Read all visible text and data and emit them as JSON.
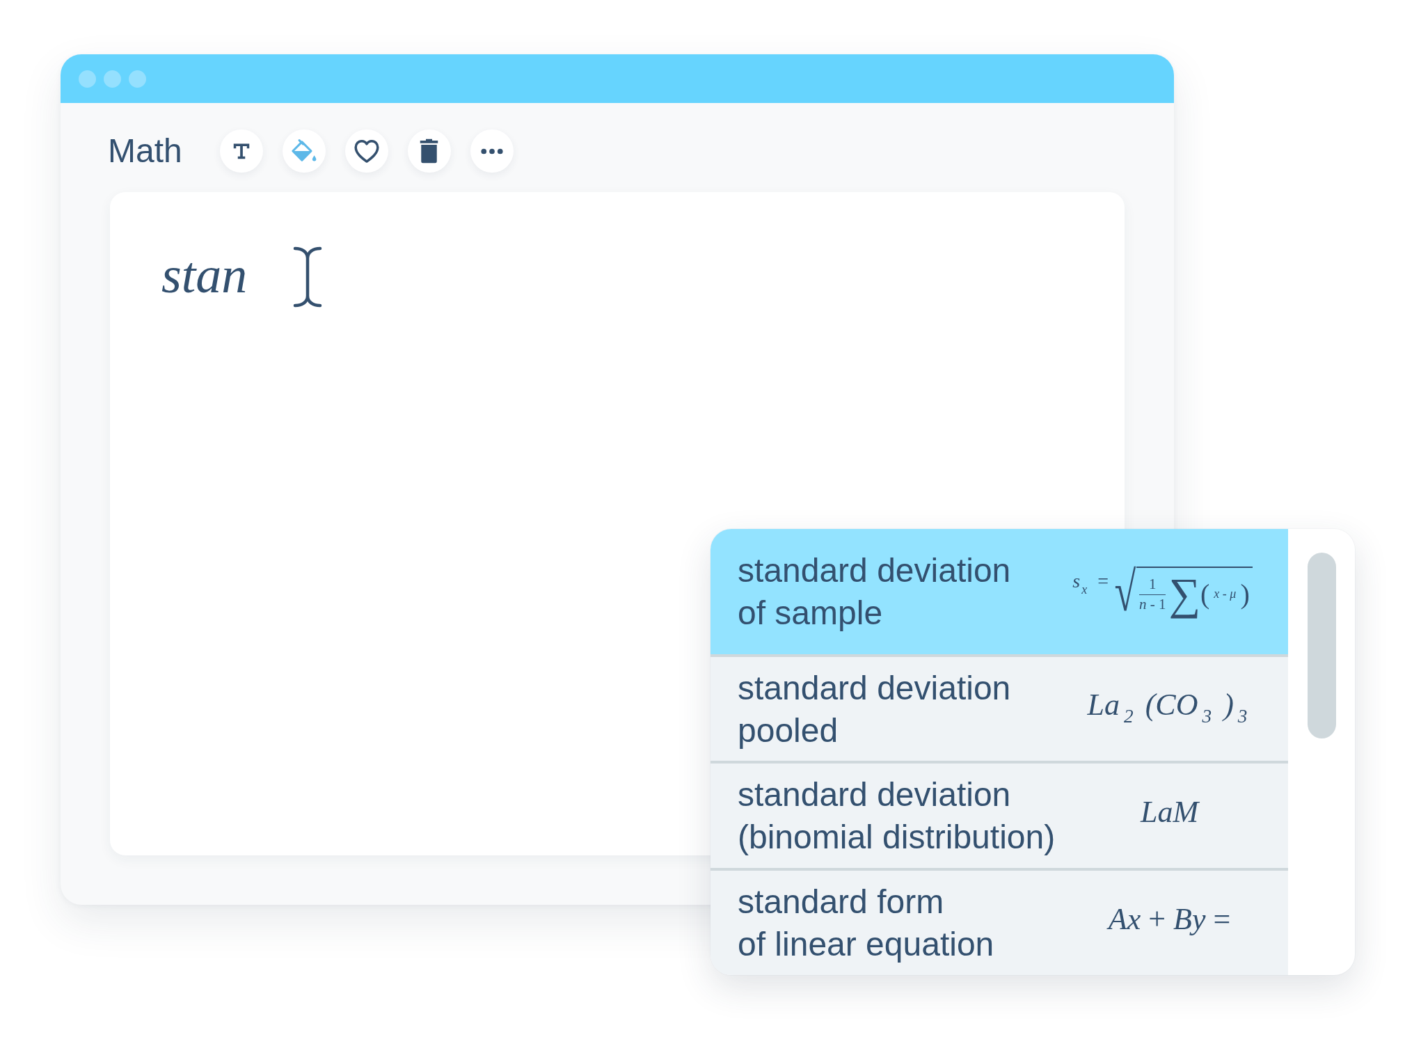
{
  "toolbar": {
    "title": "Math"
  },
  "editor": {
    "value": "stan"
  },
  "suggestions": [
    {
      "label": "standard deviation\nof sample",
      "selected": true,
      "formula": {
        "kind": "root",
        "lhs": "*s*$_{x}$ =",
        "radical": "√",
        "numerator": "1",
        "denominator": "*n* - 1",
        "operator": "∑",
        "open": "(",
        "argument": "*x* - *μ*",
        "close": ")"
      }
    },
    {
      "label": "standard deviation\npooled",
      "selected": false,
      "formula": {
        "kind": "italic",
        "text": "La$_{2}$ (CO$_{3}$ )$_{3}$"
      }
    },
    {
      "label": "standard deviation\n(binomial distribution)",
      "selected": false,
      "formula": {
        "kind": "italic",
        "text": "LaM"
      }
    },
    {
      "label": "standard form\nof linear equation",
      "selected": false,
      "formula": {
        "kind": "plain",
        "text": "*Ax* + *By* ="
      }
    }
  ]
}
